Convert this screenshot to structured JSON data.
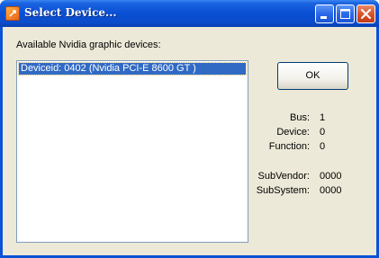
{
  "window": {
    "title": "Select Device..."
  },
  "title_buttons": [
    "minimize",
    "maximize",
    "close"
  ],
  "dialog": {
    "available_label": "Available  Nvidia graphic devices:",
    "devices": [
      {
        "label": "Deviceid: 0402 (Nvidia PCI-E 8600 GT )",
        "selected": true
      }
    ],
    "ok_label": "OK",
    "info": [
      {
        "label": "Bus:",
        "value": "1"
      },
      {
        "label": "Device:",
        "value": "0"
      },
      {
        "label": "Function:",
        "value": "0"
      },
      {
        "label": "SubVendor:",
        "value": "0000"
      },
      {
        "label": "SubSystem:",
        "value": "0000"
      }
    ]
  },
  "colors": {
    "titlebar": "#0a4fd4",
    "client_bg": "#ece9d8",
    "selection": "#316ac5",
    "close_button": "#d9542a"
  }
}
